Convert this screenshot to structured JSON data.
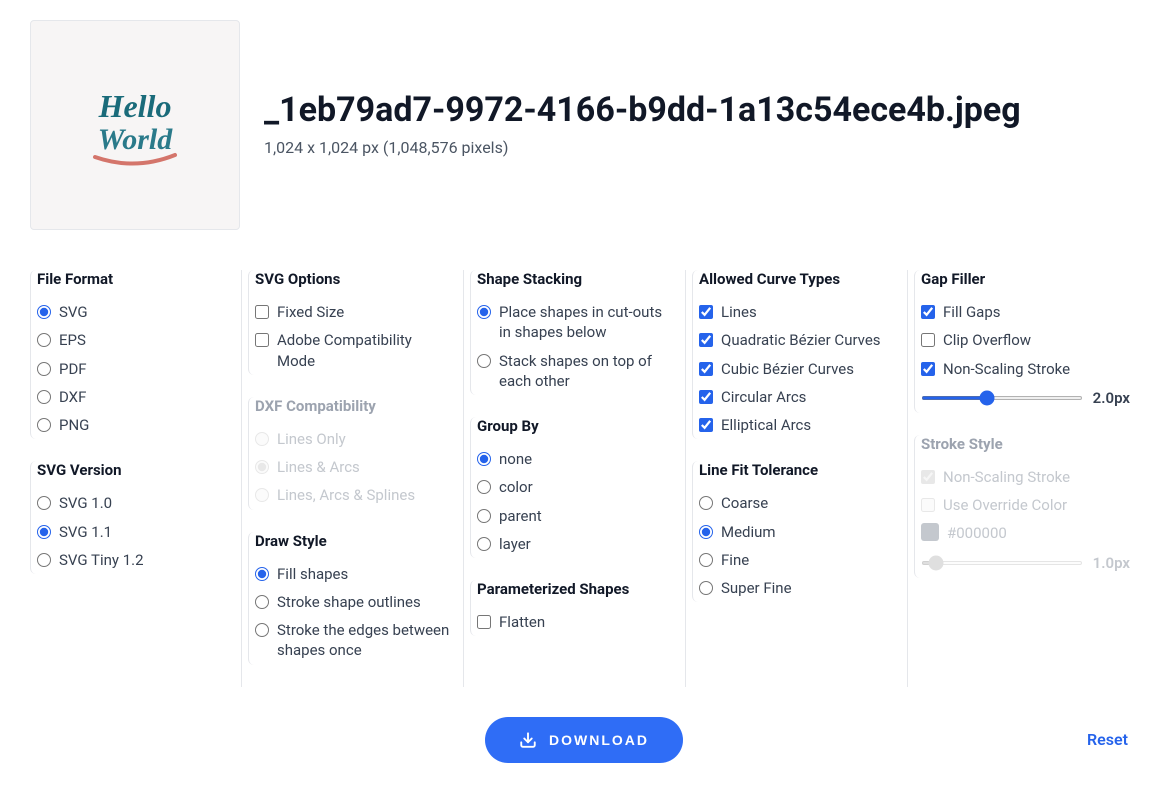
{
  "file": {
    "name": "_1eb79ad7-9972-4166-b9dd-1a13c54ece4b.jpeg",
    "dimensions": "1,024 x 1,024 px (1,048,576 pixels)"
  },
  "sections": {
    "fileFormat": {
      "title": "File Format",
      "options": [
        "SVG",
        "EPS",
        "PDF",
        "DXF",
        "PNG"
      ],
      "selected": "SVG"
    },
    "svgVersion": {
      "title": "SVG Version",
      "options": [
        "SVG 1.0",
        "SVG 1.1",
        "SVG Tiny 1.2"
      ],
      "selected": "SVG 1.1"
    },
    "svgOptions": {
      "title": "SVG Options",
      "options": [
        "Fixed Size",
        "Adobe Compatibility Mode"
      ],
      "checked": []
    },
    "dxfCompat": {
      "title": "DXF Compatibility",
      "options": [
        "Lines Only",
        "Lines & Arcs",
        "Lines, Arcs & Splines"
      ],
      "selected": "Lines & Arcs",
      "disabled": true
    },
    "drawStyle": {
      "title": "Draw Style",
      "options": [
        "Fill shapes",
        "Stroke shape outlines",
        "Stroke the edges between shapes once"
      ],
      "selected": "Fill shapes"
    },
    "shapeStacking": {
      "title": "Shape Stacking",
      "options": [
        "Place shapes in cut-outs in shapes below",
        "Stack shapes on top of each other"
      ],
      "selected": "Place shapes in cut-outs in shapes below"
    },
    "groupBy": {
      "title": "Group By",
      "options": [
        "none",
        "color",
        "parent",
        "layer"
      ],
      "selected": "none"
    },
    "paramShapes": {
      "title": "Parameterized Shapes",
      "options": [
        "Flatten"
      ],
      "checked": []
    },
    "curveTypes": {
      "title": "Allowed Curve Types",
      "options": [
        "Lines",
        "Quadratic Bézier Curves",
        "Cubic Bézier Curves",
        "Circular Arcs",
        "Elliptical Arcs"
      ],
      "checked": [
        "Lines",
        "Quadratic Bézier Curves",
        "Cubic Bézier Curves",
        "Circular Arcs",
        "Elliptical Arcs"
      ]
    },
    "lineFit": {
      "title": "Line Fit Tolerance",
      "options": [
        "Coarse",
        "Medium",
        "Fine",
        "Super Fine"
      ],
      "selected": "Medium"
    },
    "gapFiller": {
      "title": "Gap Filler",
      "options": [
        "Fill Gaps",
        "Clip Overflow",
        "Non-Scaling Stroke"
      ],
      "checked": [
        "Fill Gaps",
        "Non-Scaling Stroke"
      ],
      "sliderValue": "2.0px",
      "sliderPercent": 40
    },
    "strokeStyle": {
      "title": "Stroke Style",
      "options": [
        "Non-Scaling Stroke",
        "Use Override Color"
      ],
      "checked": [
        "Non-Scaling Stroke"
      ],
      "disabled": true,
      "colorValue": "#000000",
      "sliderValue": "1.0px",
      "sliderPercent": 5
    }
  },
  "buttons": {
    "download": "DOWNLOAD",
    "reset": "Reset"
  }
}
